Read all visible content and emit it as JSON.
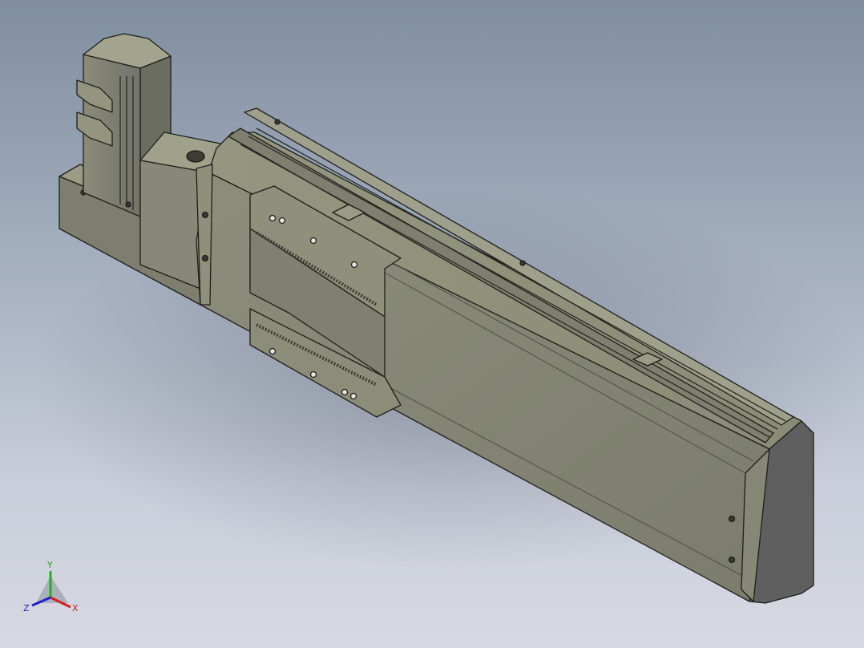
{
  "triad": {
    "x_label": "X",
    "y_label": "Y",
    "z_label": "Z"
  },
  "colors": {
    "background_top": "#7f8ea0",
    "background_bottom": "#d7d9e2",
    "body_light": "#8a8b78",
    "body_mid": "#77786a",
    "body_dark": "#5c5d52",
    "end_cap": "#606060",
    "edge": "#1e1e1a",
    "x_axis": "#d02020",
    "y_axis": "#20b020",
    "z_axis": "#2020d0"
  }
}
